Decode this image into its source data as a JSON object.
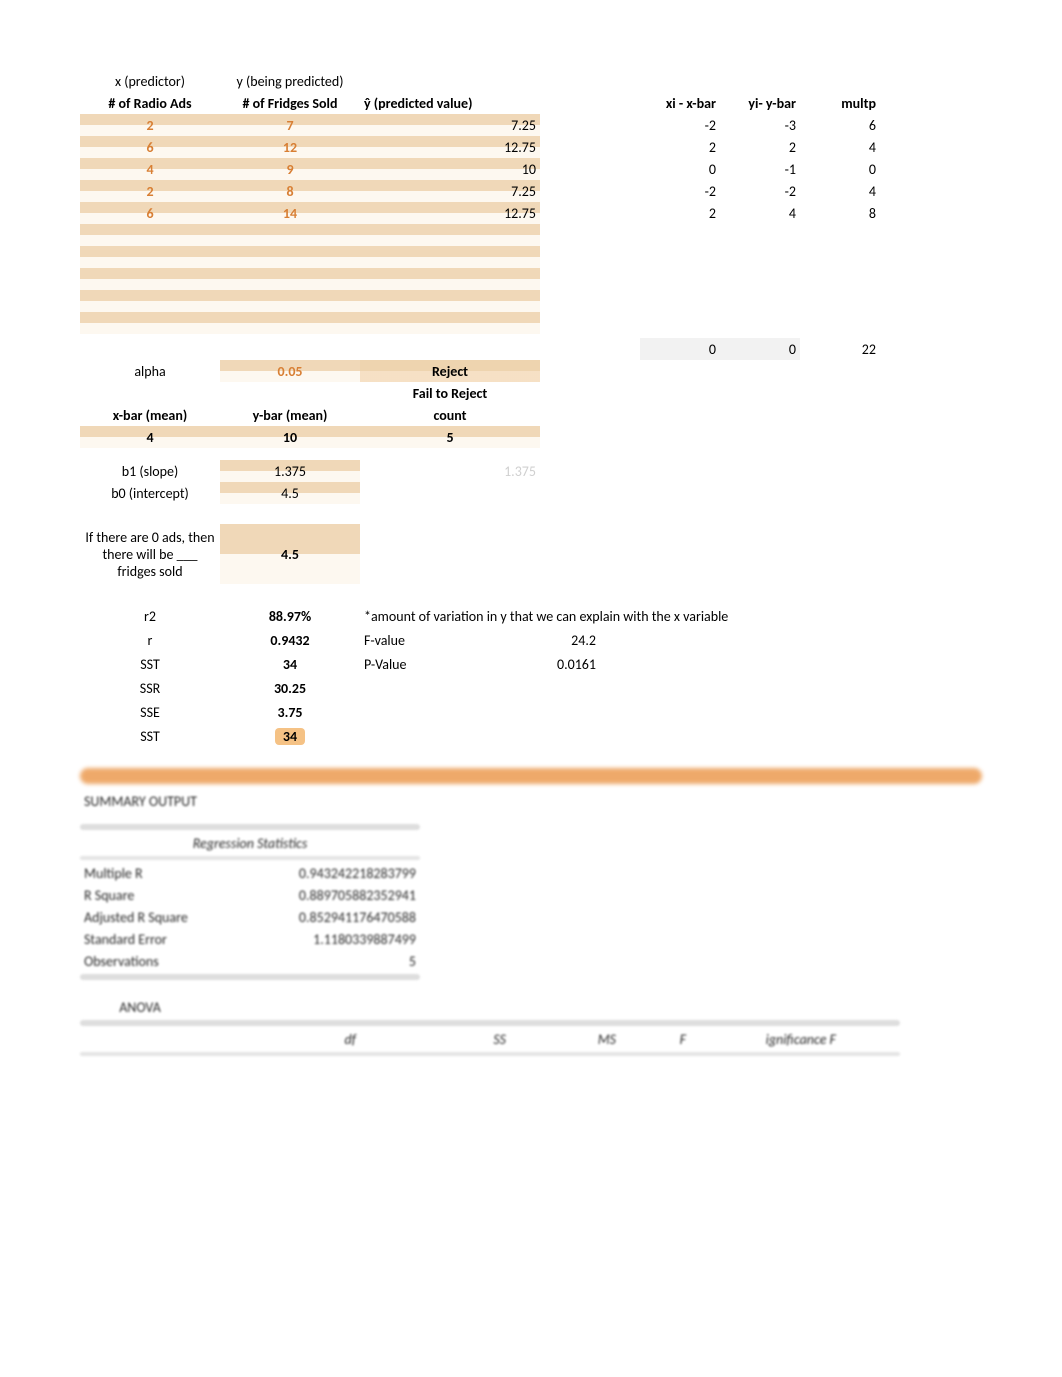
{
  "headers": {
    "x_predictor": "x (predictor)",
    "y_predicted": "y (being predicted)",
    "x_label": "# of Radio Ads",
    "y_label": "# of Fridges Sold",
    "yhat_label": "ŷ (predicted value)",
    "xi_xbar": "xi - x-bar",
    "yi_ybar": "yi- y-bar",
    "multp": "multp"
  },
  "data_rows": [
    {
      "x": "2",
      "y": "7",
      "yhat": "7.25",
      "dx": "-2",
      "dy": "-3",
      "m": "6"
    },
    {
      "x": "6",
      "y": "12",
      "yhat": "12.75",
      "dx": "2",
      "dy": "2",
      "m": "4"
    },
    {
      "x": "4",
      "y": "9",
      "yhat": "10",
      "dx": "0",
      "dy": "-1",
      "m": "0"
    },
    {
      "x": "2",
      "y": "8",
      "yhat": "7.25",
      "dx": "-2",
      "dy": "-2",
      "m": "4"
    },
    {
      "x": "6",
      "y": "14",
      "yhat": "12.75",
      "dx": "2",
      "dy": "4",
      "m": "8"
    }
  ],
  "dev_sums": {
    "dx": "0",
    "dy": "0",
    "m": "22"
  },
  "alpha_label": "alpha",
  "alpha_value": "0.05",
  "decision_reject": "Reject",
  "decision_fail": "Fail to Reject",
  "xbar_label": "x-bar (mean)",
  "ybar_label": "y-bar (mean)",
  "count_label": "count",
  "xbar_value": "4",
  "ybar_value": "10",
  "count_value": "5",
  "b1_label": "b1 (slope)",
  "b1_value": "1.375",
  "b1_faded": "1.375",
  "b0_label": "b0 (intercept)",
  "b0_value": "4.5",
  "interp_label": "If there are 0 ads, then there will be ___ fridges sold",
  "interp_value": "4.5",
  "stats": {
    "r2_label": "r2",
    "r2_value": "88.97%",
    "r2_note": "*amount of variation in y that we can explain with the x variable",
    "r_label": "r",
    "r_value": "0.9432",
    "f_label": "F-value",
    "f_value": "24.2",
    "p_label": "P-Value",
    "p_value": "0.0161",
    "sst_label": "SST",
    "sst_value": "34",
    "ssr_label": "SSR",
    "ssr_value": "30.25",
    "sse_label": "SSE",
    "sse_value": "3.75",
    "sst2_label": "SST",
    "sst2_value": "34"
  },
  "summary_title": "SUMMARY OUTPUT",
  "reg_header": "Regression Statistics",
  "regression": [
    {
      "label": "Multiple R",
      "value": "0.943242218283799"
    },
    {
      "label": "R Square",
      "value": "0.889705882352941"
    },
    {
      "label": "Adjusted R Square",
      "value": "0.852941176470588"
    },
    {
      "label": "Standard Error",
      "value": "1.1180339887499"
    },
    {
      "label": "Observations",
      "value": "5"
    }
  ],
  "anova_title": "ANOVA",
  "anova_headers": {
    "df": "df",
    "ss": "SS",
    "ms": "MS",
    "f": "F",
    "sigf": "ignificance F"
  }
}
